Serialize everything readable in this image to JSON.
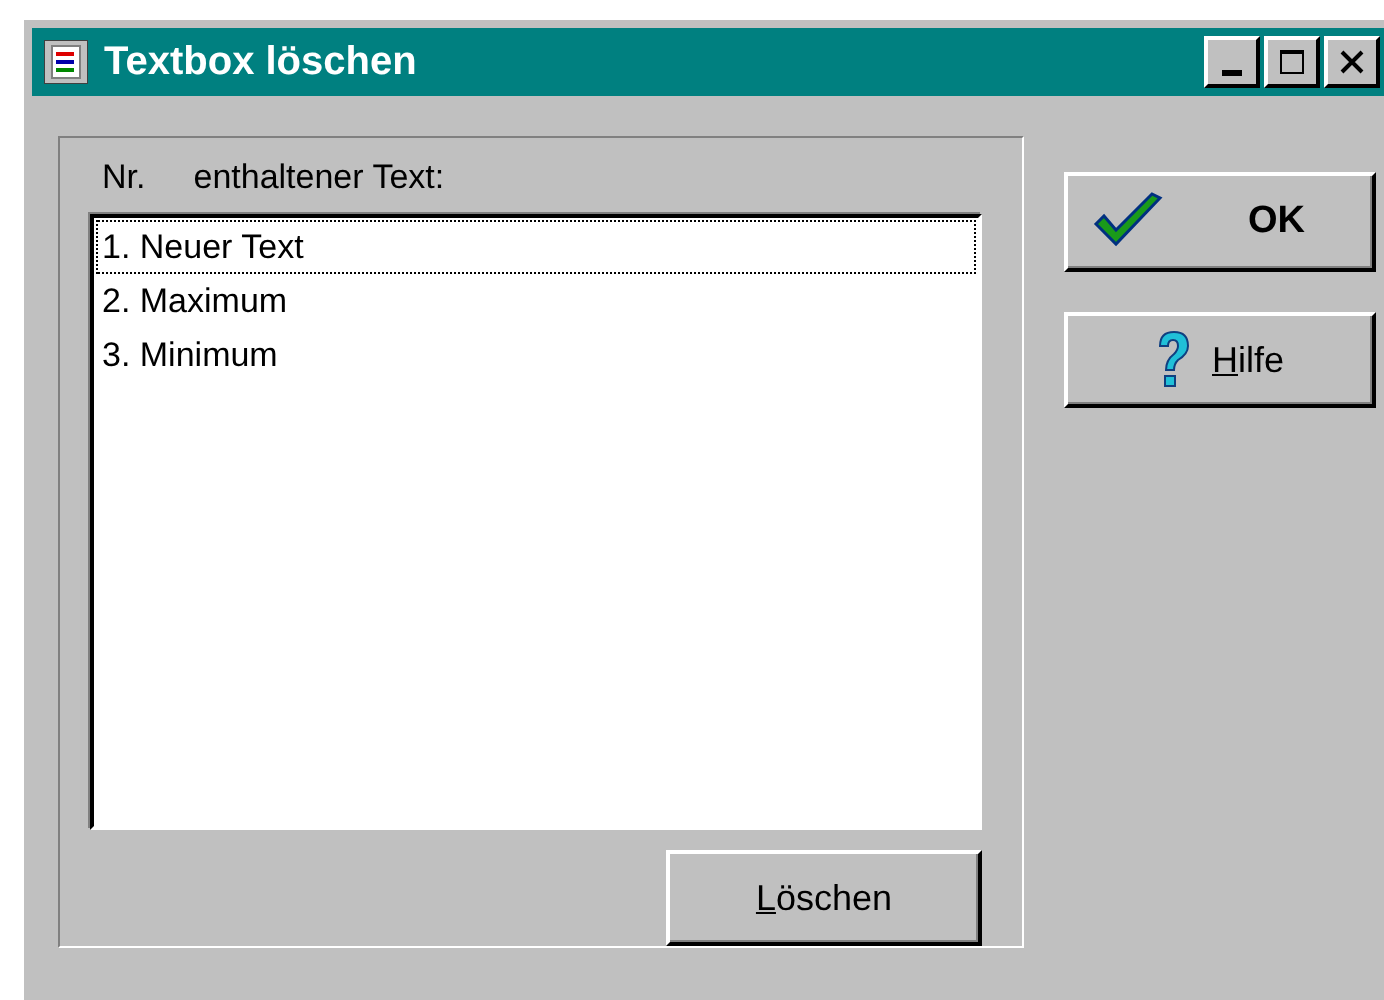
{
  "window": {
    "title": "Textbox löschen"
  },
  "list": {
    "header_number": "Nr.",
    "header_text": "enthaltener Text:",
    "items": [
      {
        "label": "1. Neuer Text",
        "selected": true
      },
      {
        "label": "2. Maximum",
        "selected": false
      },
      {
        "label": "3. Minimum",
        "selected": false
      }
    ]
  },
  "buttons": [
    {
      "kind": "ok",
      "label": "OK"
    },
    {
      "kind": "help",
      "label": "Hilfe"
    },
    {
      "kind": "delete",
      "label": "Löschen"
    }
  ]
}
